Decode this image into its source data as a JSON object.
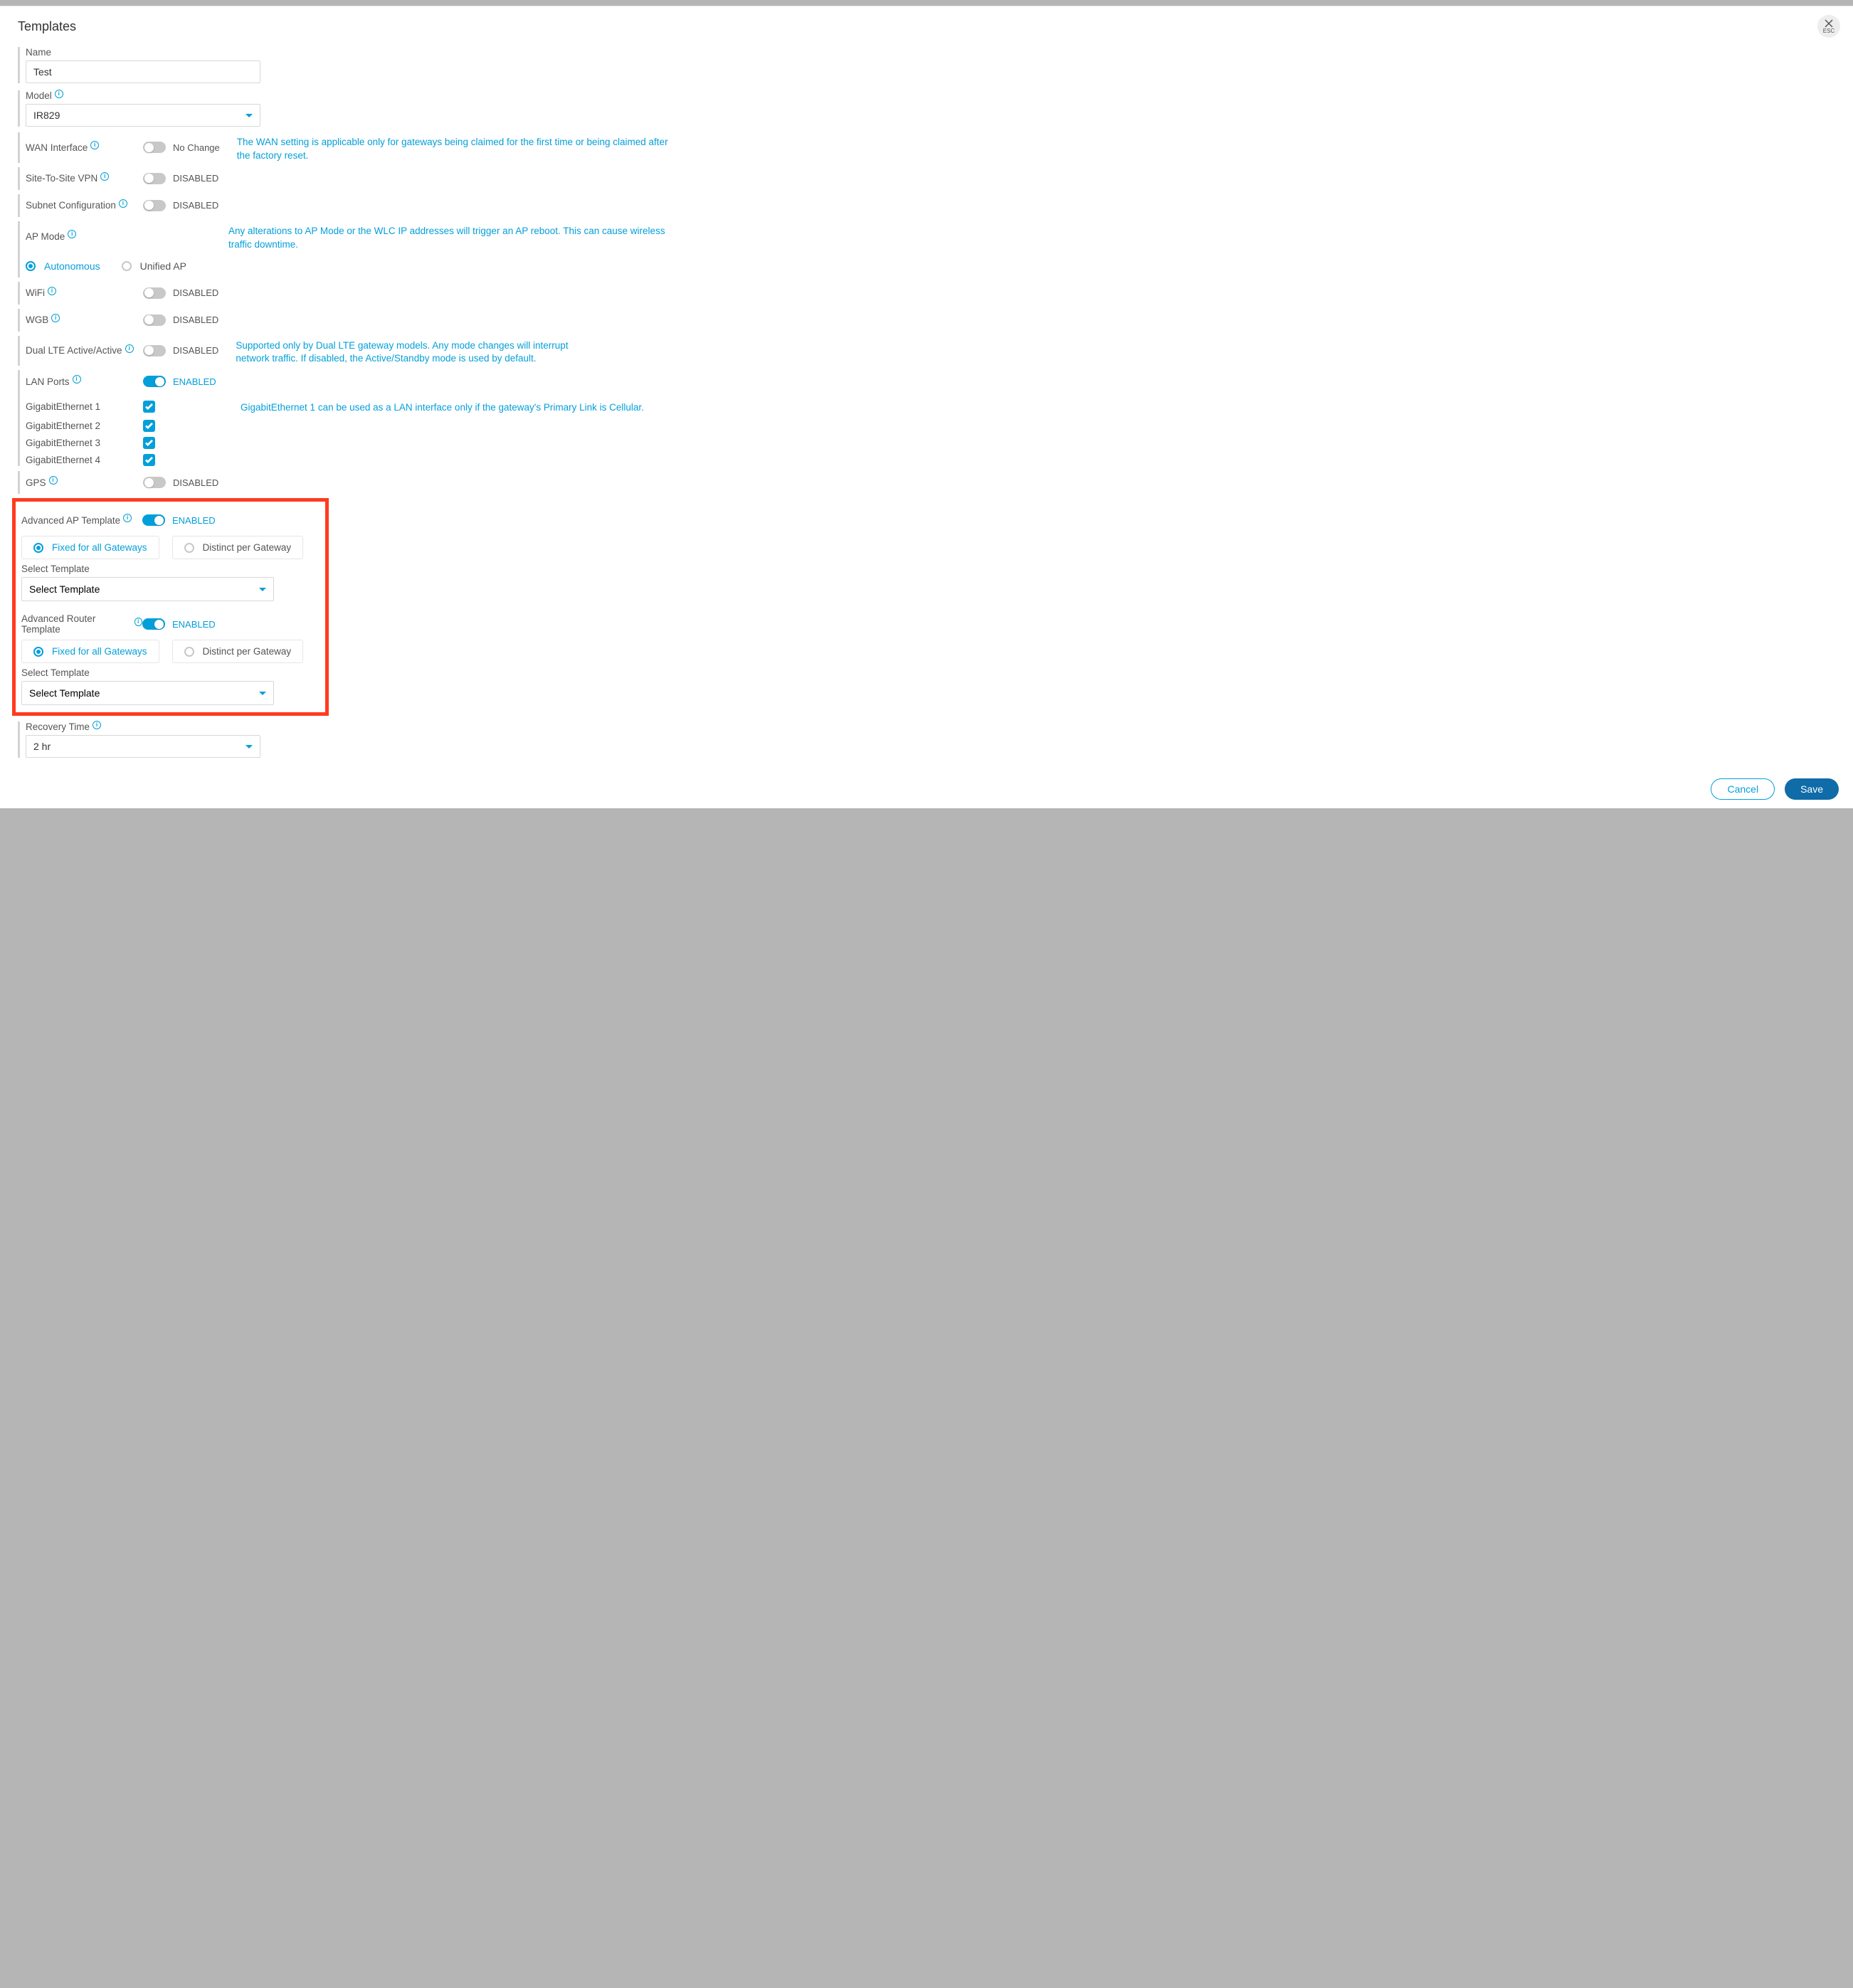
{
  "title": "Templates",
  "close_label": "ESC",
  "name": {
    "label": "Name",
    "value": "Test"
  },
  "model": {
    "label": "Model",
    "value": "IR829"
  },
  "wan": {
    "label": "WAN Interface",
    "toggle": false,
    "state": "No Change",
    "note": "The WAN setting is applicable only for gateways being claimed for the first time or being claimed after the factory reset."
  },
  "s2s": {
    "label": "Site-To-Site VPN",
    "toggle": false,
    "state": "DISABLED"
  },
  "subnet": {
    "label": "Subnet Configuration",
    "toggle": false,
    "state": "DISABLED"
  },
  "apmode": {
    "label": "AP Mode",
    "note": "Any alterations to AP Mode or the WLC IP addresses will trigger an AP reboot. This can cause wireless traffic downtime.",
    "opt1": "Autonomous",
    "opt2": "Unified AP",
    "selected": "Autonomous"
  },
  "wifi": {
    "label": "WiFi",
    "toggle": false,
    "state": "DISABLED"
  },
  "wgb": {
    "label": "WGB",
    "toggle": false,
    "state": "DISABLED"
  },
  "dual": {
    "label": "Dual LTE Active/Active",
    "toggle": false,
    "state": "DISABLED",
    "note": "Supported only by Dual LTE gateway models. Any mode changes will interrupt network traffic. If disabled, the Active/Standby mode is used by default."
  },
  "lan": {
    "label": "LAN Ports",
    "toggle": true,
    "state": "ENABLED",
    "items": [
      "GigabitEthernet 1",
      "GigabitEthernet 2",
      "GigabitEthernet 3",
      "GigabitEthernet 4"
    ],
    "note": "GigabitEthernet 1 can be used as a LAN interface only if the gateway's Primary Link is Cellular."
  },
  "gps": {
    "label": "GPS",
    "toggle": false,
    "state": "DISABLED"
  },
  "advap": {
    "label": "Advanced AP Template",
    "toggle": true,
    "state": "ENABLED",
    "opt1": "Fixed for all Gateways",
    "opt2": "Distinct per Gateway",
    "select_label": "Select Template",
    "select_placeholder": "Select Template"
  },
  "advrt": {
    "label": "Advanced Router Template",
    "toggle": true,
    "state": "ENABLED",
    "opt1": "Fixed for all Gateways",
    "opt2": "Distinct per Gateway",
    "select_label": "Select Template",
    "select_placeholder": "Select Template"
  },
  "recovery": {
    "label": "Recovery Time",
    "value": "2 hr"
  },
  "buttons": {
    "cancel": "Cancel",
    "save": "Save"
  }
}
